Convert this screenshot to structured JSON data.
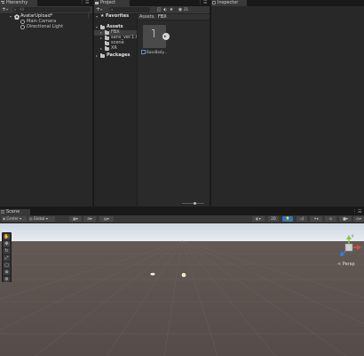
{
  "hierarchy": {
    "tab_label": "Hierarchy",
    "add_label": "+",
    "search_placeholder": "All",
    "scene_name": "AvatarUpload*",
    "items": [
      "Main Camera",
      "Directional Light"
    ]
  },
  "project": {
    "tab_label": "Project",
    "add_label": "+",
    "hidden_count": "21",
    "favorites_label": "Favorites",
    "assets_label": "Assets",
    "folders": [
      "FBX",
      "sans_ver.1.0",
      "scene",
      "XR"
    ],
    "packages_label": "Packages",
    "breadcrumb": [
      "Assets",
      "FBX"
    ],
    "asset_name": "BaseBody..."
  },
  "inspector": {
    "tab_label": "Inspector"
  },
  "scene": {
    "tab_label": "Scene",
    "pivot_label": "Center",
    "space_label": "Global",
    "mode_label": "2D",
    "persp_label": "< Persp",
    "axis_y": "y",
    "axis_x": "x",
    "axis_z": "z"
  },
  "colors": {
    "accent": "#3a72b0",
    "sky": "#dce4ec",
    "ground": "#534a47"
  }
}
